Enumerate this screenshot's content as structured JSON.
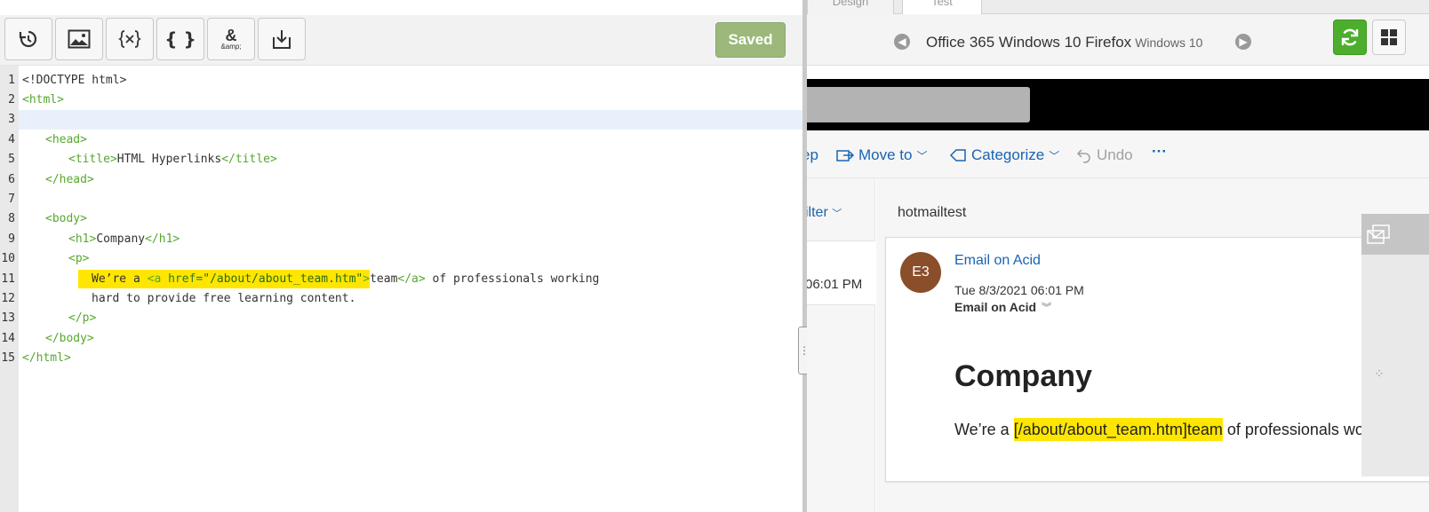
{
  "editor": {
    "toolbar": {
      "buttons": [
        {
          "name": "history-button",
          "icon": "history-icon"
        },
        {
          "name": "image-button",
          "icon": "image-icon"
        },
        {
          "name": "variables-button",
          "icon": "variables-icon"
        },
        {
          "name": "code-braces-button",
          "icon": "braces-icon"
        },
        {
          "name": "encode-entities-button",
          "icon": "ampersand-icon",
          "label": "&amp;"
        },
        {
          "name": "download-button",
          "icon": "download-icon"
        }
      ],
      "braces_label": "{ }",
      "ampersand_label": "&",
      "ampersand_sub": "&amp;",
      "saved_label": "Saved"
    },
    "line_numbers": [
      "1",
      "2",
      "3",
      "4",
      "5",
      "6",
      "7",
      "8",
      "9",
      "10",
      "11",
      "12",
      "13",
      "14",
      "15"
    ],
    "code": {
      "l1": "<!DOCTYPE html>",
      "l2_tag": "<html>",
      "l4_tag": "<head>",
      "l5_open": "<title>",
      "l5_text": "HTML Hyperlinks",
      "l5_close": "</title>",
      "l6_tag": "</head>",
      "l8_tag": "<body>",
      "l9_open": "<h1>",
      "l9_text": "Company",
      "l9_close": "</h1>",
      "l10_tag": "<p>",
      "l11_text1": "We’re a ",
      "l11_tag_open": "<a ",
      "l11_attr": "href=",
      "l11_val": "\"/about/about_team.htm\"",
      "l11_tag_close": ">",
      "l11_text2": "team",
      "l11_end_tag": "</a>",
      "l11_text3": " of professionals working",
      "l12_text": "hard to provide free learning content.",
      "l13_tag": "</p>",
      "l14_tag": "</body>",
      "l15_tag": "</html>"
    }
  },
  "preview": {
    "tabs": [
      "Design",
      "Test"
    ],
    "device": {
      "name": "Office 365 Windows 10 Firefox",
      "os": "Windows 10"
    },
    "commands": {
      "keep": "ep",
      "move_to": "Move to",
      "categorize": "Categorize",
      "undo": "Undo",
      "more": "···"
    },
    "list": {
      "filter": "ilter",
      "time": "06:01 PM"
    },
    "email": {
      "subject": "hotmailtest",
      "avatar_initials": "E3",
      "sender": "Email on Acid",
      "date": "Tue 8/3/2021 06:01 PM",
      "to": "Email on Acid",
      "heading": "Company",
      "para_before": "We’re a ",
      "para_highlight": "[/about/about_team.htm]team",
      "para_after": " of professionals worki"
    }
  },
  "colors": {
    "accent_link": "#1a63b0",
    "saved_button": "#9cb87a",
    "refresh_button": "#4cae2c",
    "highlight": "#ffe600",
    "avatar": "#8a4e2a"
  }
}
